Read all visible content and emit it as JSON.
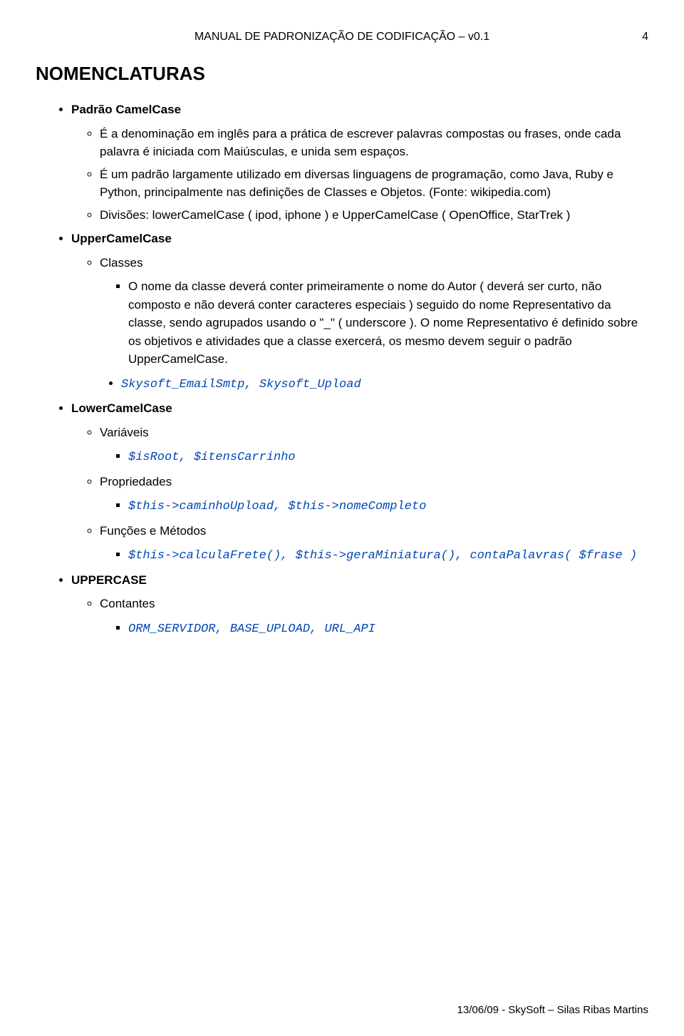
{
  "header": {
    "title": "MANUAL DE PADRONIZAÇÃO DE CODIFICAÇÃO – v0.1",
    "page_number": "4"
  },
  "h1": "NOMENCLATURAS",
  "sections": {
    "camelcase": {
      "title": "Padrão CamelCase",
      "p1": "É a denominação em inglês para a prática de escrever palavras compostas ou frases, onde cada palavra é iniciada com Maiúsculas, e unida sem espaços.",
      "p2": "É um padrão largamente utilizado em diversas linguagens de programação, como Java, Ruby e Python, principalmente nas definições de Classes e Objetos. (Fonte: wikipedia.com)",
      "p3": "Divisões: lowerCamelCase ( ipod, iphone ) e UpperCamelCase ( OpenOffice, StarTrek  )"
    },
    "upper": {
      "title": "UpperCamelCase",
      "classes": {
        "title": "Classes",
        "p1": "O nome da classe deverá conter primeiramente o nome do Autor ( deverá ser curto, não composto e não deverá conter caracteres especiais )  seguido do nome Representativo da classe, sendo agrupados  usando o \"_\" ( underscore ). O nome Representativo é definido sobre os objetivos e atividades que a classe exercerá, os mesmo devem seguir o padrão UpperCamelCase.",
        "code": "Skysoft_EmailSmtp, Skysoft_Upload"
      }
    },
    "lower": {
      "title": "LowerCamelCase",
      "variaveis": {
        "title": "Variáveis",
        "code": "$isRoot, $itensCarrinho"
      },
      "propriedades": {
        "title": "Propriedades",
        "code": "$this->caminhoUpload, $this->nomeCompleto"
      },
      "funcoes": {
        "title": "Funções e Métodos",
        "code": "$this->calculaFrete(), $this->geraMiniatura(), contaPalavras( $frase )"
      }
    },
    "uppercase": {
      "title": "UPPERCASE",
      "contantes": {
        "title": "Contantes",
        "code": "ORM_SERVIDOR, BASE_UPLOAD, URL_API"
      }
    }
  },
  "footer": "13/06/09 - SkySoft – Silas Ribas Martins"
}
